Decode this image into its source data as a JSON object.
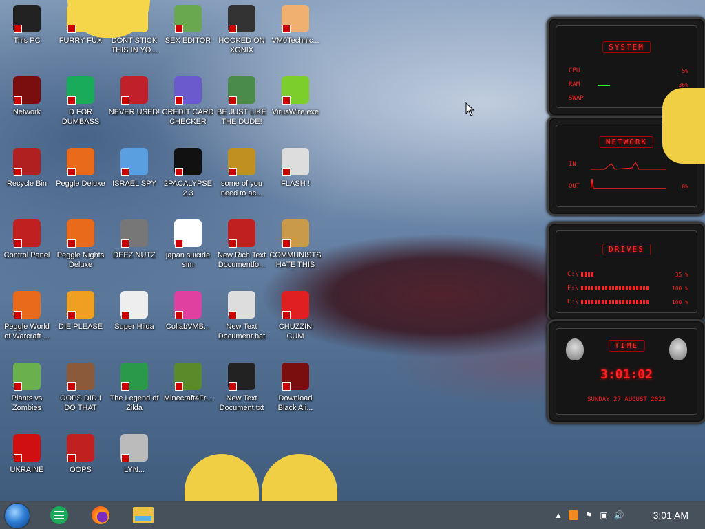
{
  "desktop_icons": [
    {
      "label": "This PC",
      "icon": "computer-icon",
      "color": "#222222"
    },
    {
      "label": "FURRY FUX",
      "icon": "cartoon-girl-icon",
      "color": "#f5d64a"
    },
    {
      "label": "DONT STICK THIS IN YO...",
      "icon": "cartoon-girl-icon",
      "color": "#f5d64a"
    },
    {
      "label": "SEX EDITOR",
      "icon": "hxd-editor-icon",
      "color": "#6aa84f"
    },
    {
      "label": "HOOKED ON XONIX",
      "icon": "maze-game-icon",
      "color": "#333333"
    },
    {
      "label": "VM0Technic...",
      "icon": "doctor-avatar-icon",
      "color": "#f0b070"
    },
    {
      "label": "Network",
      "icon": "network-orb-icon",
      "color": "#7a0d0d"
    },
    {
      "label": "D FOR DUMBASS",
      "icon": "green-chat-icon",
      "color": "#1aab5a"
    },
    {
      "label": "NEVER USED!",
      "icon": "dev-cpp-icon",
      "color": "#c0202a"
    },
    {
      "label": "CREDIT CARD CHECKER",
      "icon": "credit-card-icon",
      "color": "#6a5acd"
    },
    {
      "label": "BE JUST LIKE THE DUDE!",
      "icon": "gnome-icon",
      "color": "#4a8a4a"
    },
    {
      "label": "VirusWire.exe",
      "icon": "lime-slice-icon",
      "color": "#7ccf2a"
    },
    {
      "label": "Recycle Bin",
      "icon": "recycle-bin-icon",
      "color": "#b02020"
    },
    {
      "label": "Peggle Deluxe",
      "icon": "peggle-icon",
      "color": "#e86a1a"
    },
    {
      "label": "ISRAEL SPY",
      "icon": "network-share-icon",
      "color": "#5aa0e0"
    },
    {
      "label": "2PACALYPSE 2.3",
      "icon": "terminal-icon",
      "color": "#111111"
    },
    {
      "label": "some of you need to ac...",
      "icon": "cartoon-dog-icon",
      "color": "#c09020"
    },
    {
      "label": "FLASH !",
      "icon": "flash-doc-icon",
      "color": "#dddddd"
    },
    {
      "label": "Control Panel",
      "icon": "control-panel-icon",
      "color": "#c02020"
    },
    {
      "label": "Peggle Nights Deluxe",
      "icon": "peggle-nights-icon",
      "color": "#e86a1a"
    },
    {
      "label": "DEEZ NUTZ",
      "icon": "stacked-windows-icon",
      "color": "#777777"
    },
    {
      "label": "japan suicide sim",
      "icon": "pixel-figures-icon",
      "color": "#ffffff"
    },
    {
      "label": "New Rich Text Documentfo...",
      "icon": "rich-text-doc-icon",
      "color": "#c02020"
    },
    {
      "label": "COMMUNISTS HATE THIS G...",
      "icon": "money-bag-icon",
      "color": "#c89a4a"
    },
    {
      "label": "Peggle World of Warcraft ...",
      "icon": "peggle-wow-icon",
      "color": "#e86a1a"
    },
    {
      "label": "DIE PLEASE",
      "icon": "de-icon",
      "color": "#f0a020"
    },
    {
      "label": "Super Hilda",
      "icon": "pixel-sprite-icon",
      "color": "#eeeeee"
    },
    {
      "label": "CollabVMB...",
      "icon": "tv-monitor-icon",
      "color": "#e040a0"
    },
    {
      "label": "New Text Document.bat",
      "icon": "gear-doc-icon",
      "color": "#dddddd"
    },
    {
      "label": "CHUZZIN CUM",
      "icon": "red-chuzzle-icon",
      "color": "#e02020"
    },
    {
      "label": "Plants vs Zombies",
      "icon": "plant-icon",
      "color": "#6ab04c"
    },
    {
      "label": "OOPS DID I DO THAT",
      "icon": "portrait-icon",
      "color": "#8a5a3a"
    },
    {
      "label": "The Legend of Zilda",
      "icon": "pixel-hero-icon",
      "color": "#2a9a4a"
    },
    {
      "label": "Minecraft4Fr...",
      "icon": "grass-block-icon",
      "color": "#5a8a2a"
    },
    {
      "label": "New Text Document.txt",
      "icon": "txt-doc-icon",
      "color": "#222222"
    },
    {
      "label": "Download Black Ali...",
      "icon": "network-orb-icon",
      "color": "#7a0d0d"
    },
    {
      "label": "UKRAINE",
      "icon": "radiation-icon",
      "color": "#d01010"
    },
    {
      "label": "OOPS",
      "icon": "rich-text-doc-icon",
      "color": "#c02020"
    },
    {
      "label": "LYN...",
      "icon": "noose-icon",
      "color": "#bbbbbb"
    }
  ],
  "widget": {
    "system": {
      "title": "SYSTEM",
      "cpu_label": "CPU",
      "cpu_value": "5%",
      "ram_label": "RAM",
      "ram_value": "36%",
      "swap_label": "SWAP",
      "swap_value": ""
    },
    "network": {
      "title": "NETWORK",
      "in_label": "IN",
      "out_label": "OUT",
      "out_value": "0%"
    },
    "drives": {
      "title": "DRIVES",
      "items": [
        {
          "label": "C:\\",
          "value": "35 %",
          "fill": 0.2
        },
        {
          "label": "F:\\",
          "value": "100 %",
          "fill": 1.0
        },
        {
          "label": "E:\\",
          "value": "100 %",
          "fill": 1.0
        }
      ]
    },
    "time": {
      "title": "TIME",
      "clock": "3:01:02",
      "date": "SUNDAY 27 AUGUST 2023"
    }
  },
  "taskbar": {
    "apps": [
      {
        "name": "start-orb-icon"
      },
      {
        "name": "green-chat-app-icon",
        "color": "#1aab5a"
      },
      {
        "name": "firefox-icon",
        "color": "#ff6a1a"
      },
      {
        "name": "file-explorer-icon",
        "color": "#f0c040"
      }
    ],
    "tray": [
      "show-hidden-icons",
      "app-tray-icon",
      "flag-icon",
      "network-icon",
      "volume-icon"
    ],
    "clock": "3:01 AM"
  },
  "colors": {
    "accent": "#ff2020",
    "taskbar": "#46515c"
  }
}
